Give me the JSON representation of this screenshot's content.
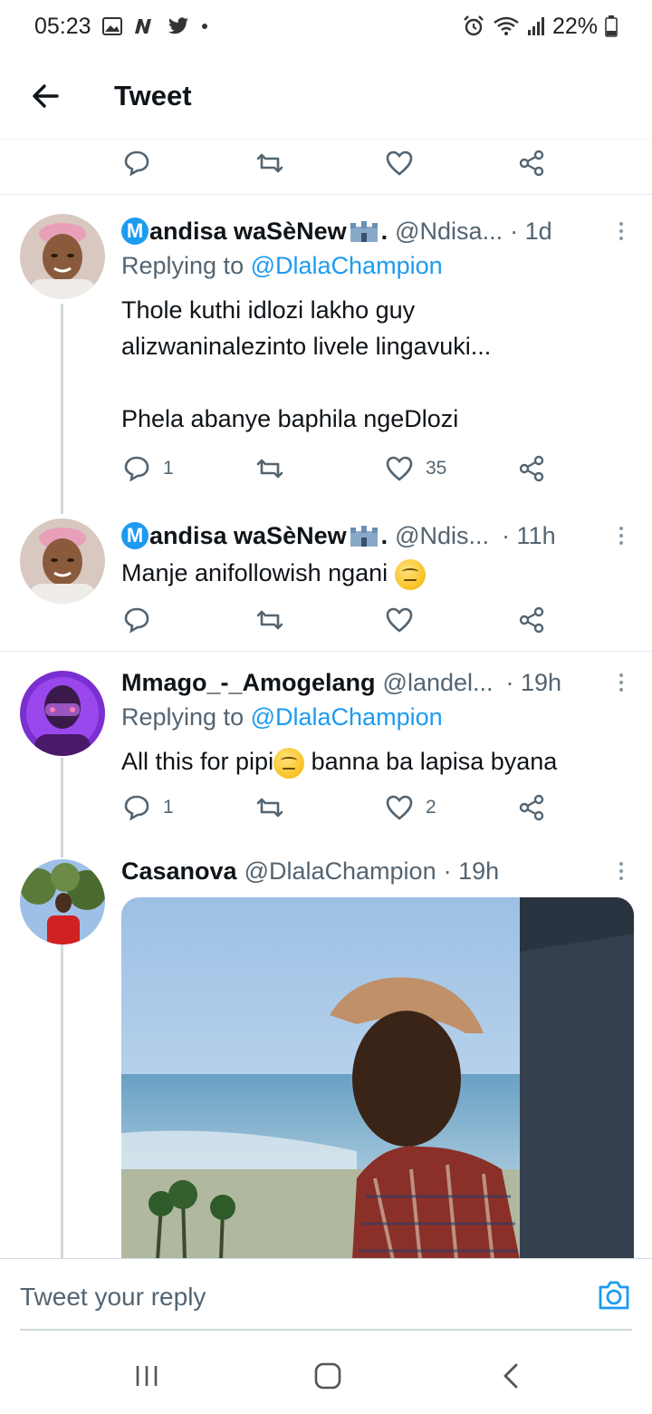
{
  "status": {
    "time": "05:23",
    "battery": "22%"
  },
  "header": {
    "title": "Tweet"
  },
  "top_actions": {
    "reply_count": "",
    "like_count": ""
  },
  "tweets": [
    {
      "name": "andisa waSèNew",
      "name_initial": "M",
      "name_suffix": ".",
      "handle": "@Ndisa...",
      "time": "· 1d",
      "replying_prefix": "Replying to",
      "replying_to": "@DlalaChampion",
      "text_line1": "Thole kuthi idlozi lakho guy",
      "text_line2": "alizwaninalezinto livele lingavuki...",
      "text_line3": "Phela abanye baphila ngeDlozi",
      "reply_count": "1",
      "like_count": "35"
    },
    {
      "name": "andisa waSèNew",
      "name_initial": "M",
      "name_suffix": ".",
      "handle": "@Ndis...",
      "time": "· 11h",
      "text": "Manje anifollowish ngani"
    },
    {
      "name": "Mmago_-_Amogelang",
      "handle": "@landel...",
      "time": "· 19h",
      "replying_prefix": "Replying to",
      "replying_to": "@DlalaChampion",
      "text_before": "All this for pipi",
      "text_after": " banna ba lapisa byana",
      "reply_count": "1",
      "like_count": "2"
    },
    {
      "name": "Casanova",
      "handle": "@DlalaChampion",
      "time": "· 19h"
    }
  ],
  "reply_bar": {
    "placeholder": "Tweet your reply"
  },
  "colors": {
    "accent": "#1d9bf0",
    "secondary_text": "#536471",
    "divider": "#e6ecf0"
  }
}
